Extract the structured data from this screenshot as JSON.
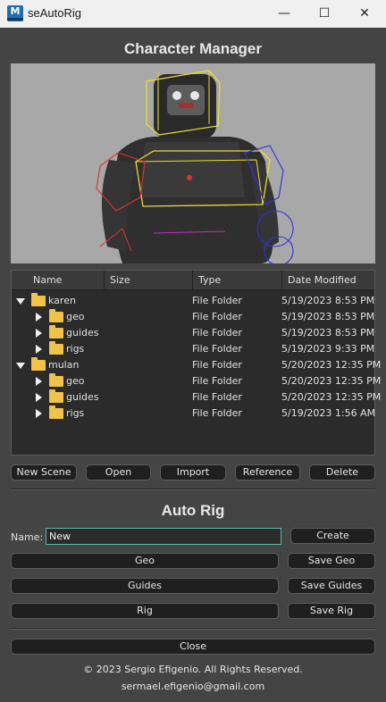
{
  "window": {
    "title": "seAutoRig",
    "app_icon": "M",
    "controls": [
      "minimize-icon",
      "maximize-icon",
      "close-icon"
    ]
  },
  "character_manager": {
    "heading": "Character Manager",
    "tree": {
      "columns": [
        "Name",
        "Size",
        "Type",
        "Date Modified"
      ],
      "rows": [
        {
          "name": "karen",
          "size": "",
          "type": "File Folder",
          "date": "5/19/2023 8:53 PM"
        },
        {
          "name": "geo",
          "size": "",
          "type": "File Folder",
          "date": "5/19/2023 8:53 PM"
        },
        {
          "name": "guides",
          "size": "",
          "type": "File Folder",
          "date": "5/19/2023 8:53 PM"
        },
        {
          "name": "rigs",
          "size": "",
          "type": "File Folder",
          "date": "5/19/2023 9:33 PM"
        },
        {
          "name": "mulan",
          "size": "",
          "type": "File Folder",
          "date": "5/20/2023 12:35 PM"
        },
        {
          "name": "geo",
          "size": "",
          "type": "File Folder",
          "date": "5/20/2023 12:35 PM"
        },
        {
          "name": "guides",
          "size": "",
          "type": "File Folder",
          "date": "5/20/2023 12:35 PM"
        },
        {
          "name": "rigs",
          "size": "",
          "type": "File Folder",
          "date": "5/19/2023 1:56 AM"
        }
      ]
    },
    "buttons": {
      "new_scene": "New Scene",
      "open": "Open",
      "import": "Import",
      "reference": "Reference",
      "delete": "Delete"
    }
  },
  "auto_rig": {
    "heading": "Auto Rig",
    "name_label": "Name:",
    "name_value": "New",
    "buttons": {
      "create": "Create",
      "geo": "Geo",
      "save_geo": "Save Geo",
      "guides": "Guides",
      "save_guides": "Save Guides",
      "rig": "Rig",
      "save_rig": "Save Rig"
    }
  },
  "close_button": "Close",
  "footer": {
    "copyright": "© 2023 Sergio Efigenio. All Rights Reserved.",
    "email": "sermael.efigenio@gmail.com"
  }
}
